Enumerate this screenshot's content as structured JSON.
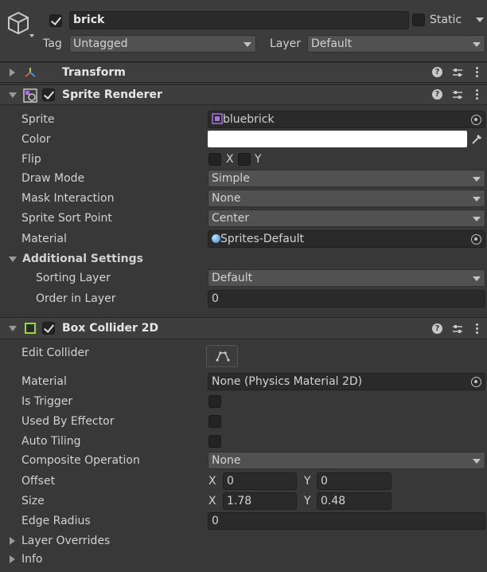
{
  "gameobject": {
    "name": "brick",
    "active": true,
    "static_label": "Static",
    "static": false,
    "tag_label": "Tag",
    "tag_value": "Untagged",
    "layer_label": "Layer",
    "layer_value": "Default"
  },
  "transform": {
    "title": "Transform"
  },
  "sprite_renderer": {
    "title": "Sprite Renderer",
    "enabled": true,
    "sprite_label": "Sprite",
    "sprite_value": "bluebrick",
    "color_label": "Color",
    "color_value": "#ffffff",
    "flip_label": "Flip",
    "flip_x_label": "X",
    "flip_y_label": "Y",
    "draw_mode_label": "Draw Mode",
    "draw_mode_value": "Simple",
    "mask_label": "Mask Interaction",
    "mask_value": "None",
    "sort_point_label": "Sprite Sort Point",
    "sort_point_value": "Center",
    "material_label": "Material",
    "material_value": "Sprites-Default",
    "additional_label": "Additional Settings",
    "sorting_layer_label": "Sorting Layer",
    "sorting_layer_value": "Default",
    "order_label": "Order in Layer",
    "order_value": "0"
  },
  "box_collider": {
    "title": "Box Collider 2D",
    "enabled": true,
    "edit_label": "Edit Collider",
    "material_label": "Material",
    "material_value": "None (Physics Material 2D)",
    "trigger_label": "Is Trigger",
    "effector_label": "Used By Effector",
    "tiling_label": "Auto Tiling",
    "composite_label": "Composite Operation",
    "composite_value": "None",
    "offset_label": "Offset",
    "offset_x": "0",
    "offset_y": "0",
    "size_label": "Size",
    "size_x": "1.78",
    "size_y": "0.48",
    "edge_label": "Edge Radius",
    "edge_value": "0",
    "x_label": "X",
    "y_label": "Y",
    "layer_overrides_label": "Layer Overrides",
    "info_label": "Info"
  },
  "colors": {
    "accent_green": "#9bd93a",
    "transform_icon": "#cf5d3b"
  }
}
